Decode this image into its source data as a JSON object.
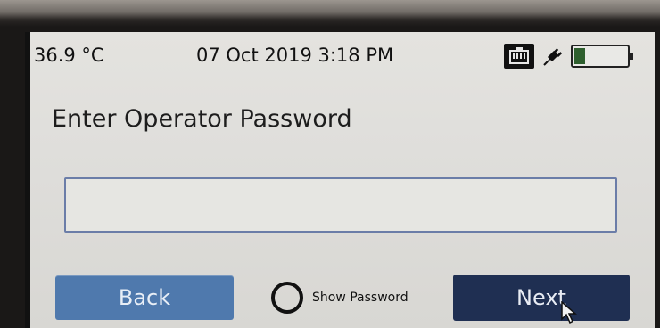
{
  "status": {
    "temperature": "36.9 °C",
    "datetime": "07 Oct 2019 3:18 PM",
    "icons": [
      "network-icon",
      "power-plug-icon",
      "battery-icon"
    ],
    "battery_level": 0.2
  },
  "prompt": {
    "title": "Enter Operator Password"
  },
  "password": {
    "value": "",
    "placeholder": ""
  },
  "actions": {
    "back_label": "Back",
    "show_password_label": "Show Password",
    "show_password_checked": false,
    "next_label": "Next"
  },
  "colors": {
    "back_button": "#4f79ad",
    "next_button": "#1f2f52",
    "field_border": "#6b7da8",
    "battery_fill": "#2e5f2e"
  }
}
